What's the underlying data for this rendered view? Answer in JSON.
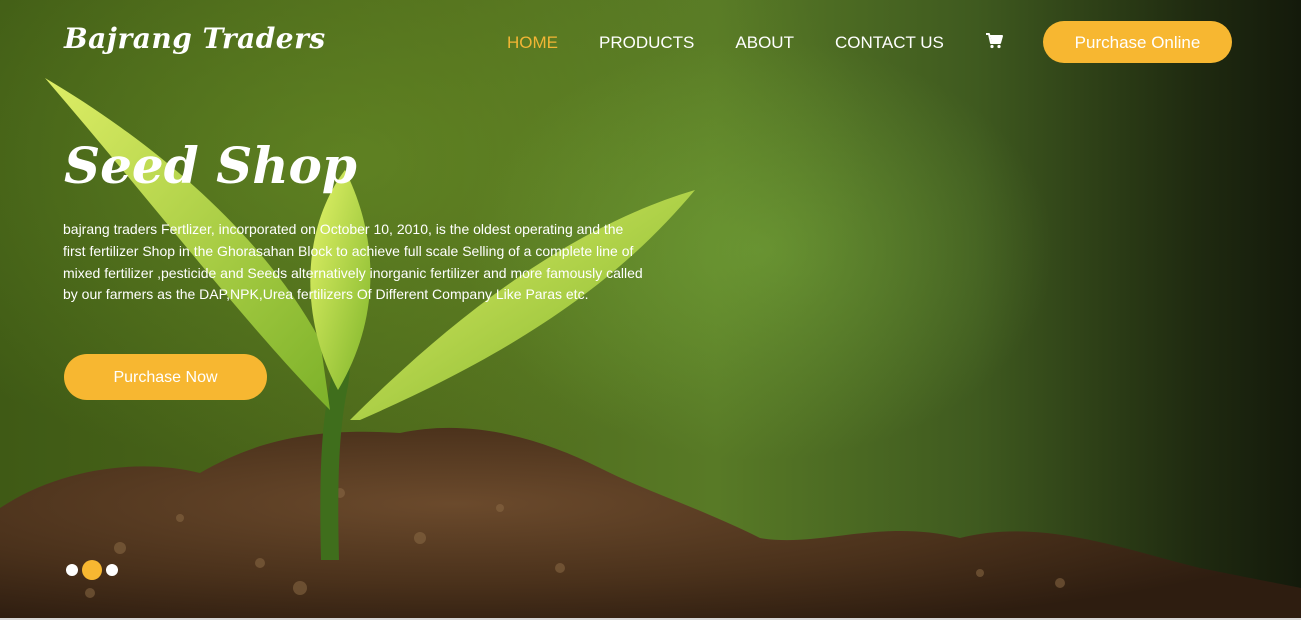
{
  "brand": {
    "logo_text": "Bajrang Traders"
  },
  "nav": {
    "items": [
      {
        "label": "HOME",
        "active": true
      },
      {
        "label": "PRODUCTS",
        "active": false
      },
      {
        "label": "ABOUT",
        "active": false
      },
      {
        "label": "CONTACT US",
        "active": false
      }
    ],
    "cart_icon": "cart-icon",
    "purchase_online_label": "Purchase Online"
  },
  "hero": {
    "title": "Seed Shop",
    "description": "bajrang traders Fertlizer, incorporated on October 10, 2010, is the oldest operating and the first fertilizer Shop in the Ghorasahan Block to achieve full scale Selling of a complete line of mixed fertilizer ,pesticide and Seeds alternatively inorganic fertilizer and more famously called by our farmers as the DAP,NPK,Urea fertilizers Of Different Company Like Paras etc.",
    "cta_label": "Purchase Now"
  },
  "carousel": {
    "slide_count": 3,
    "active_index": 1
  },
  "colors": {
    "accent": "#f7b731",
    "nav_active": "#f2b535",
    "text": "#ffffff"
  }
}
